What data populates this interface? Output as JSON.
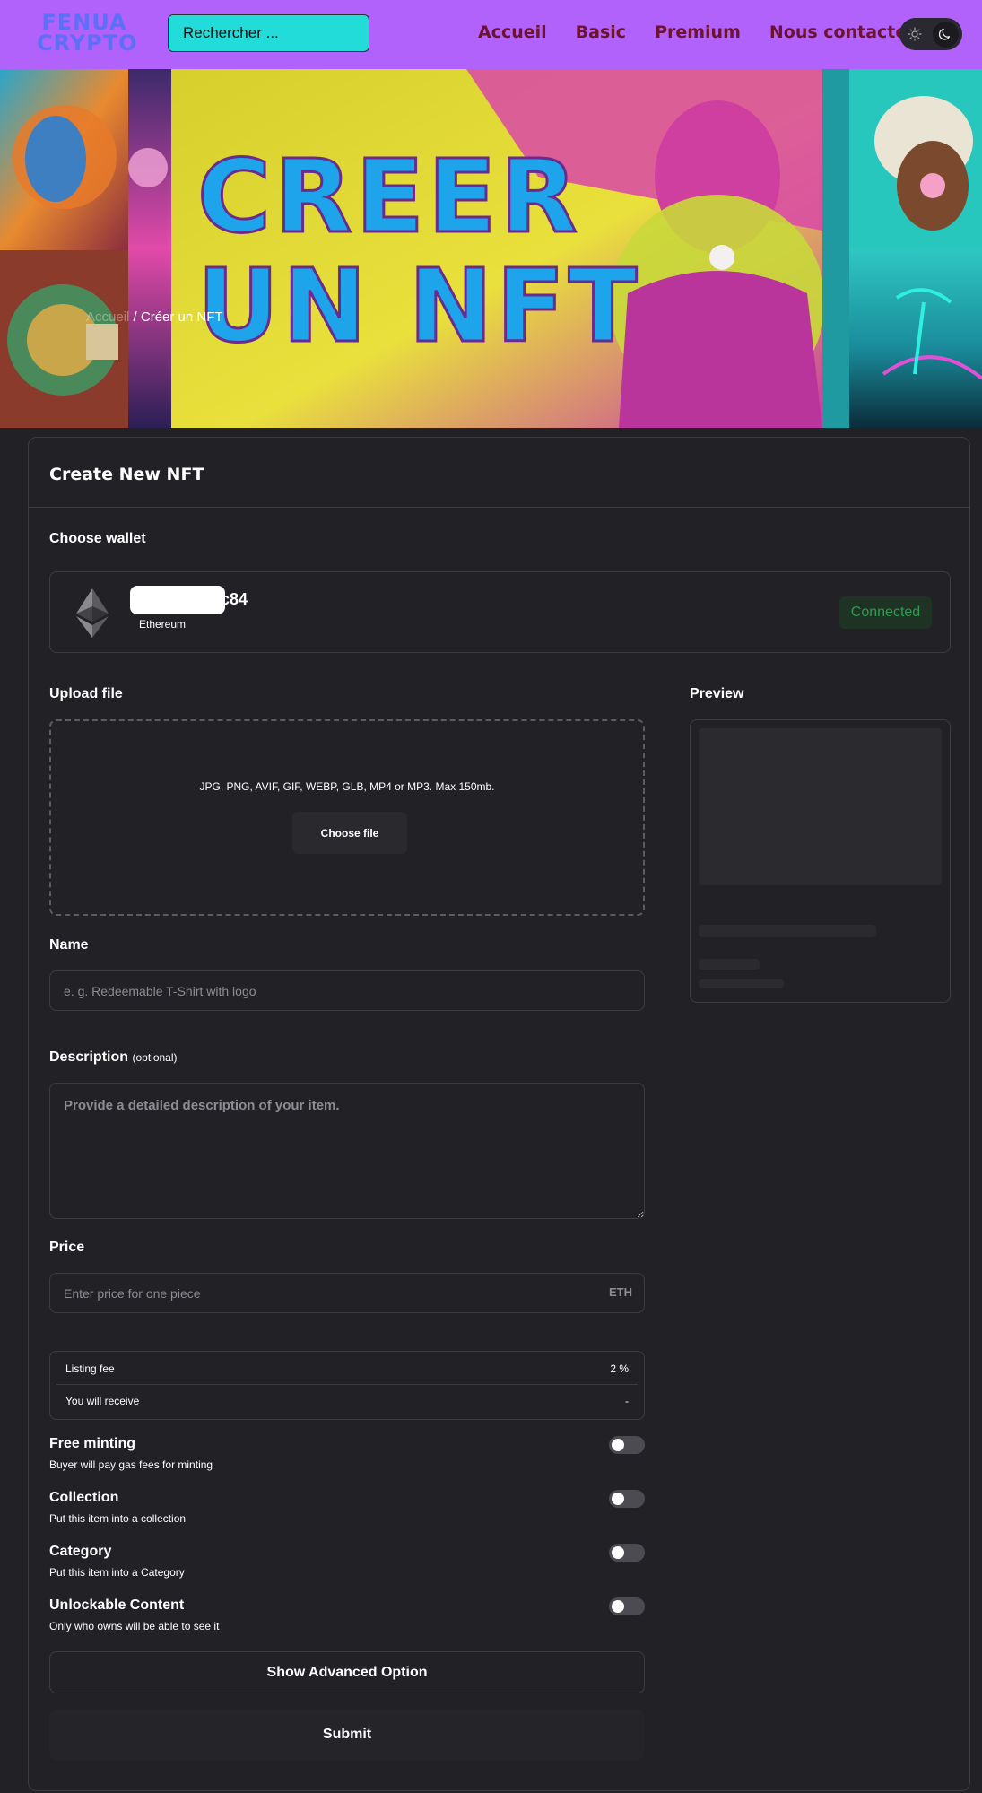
{
  "header": {
    "logo_line1": "FENUA",
    "logo_line2": "CRYPTO",
    "search_placeholder": "Rechercher ...",
    "nav": [
      "Accueil",
      "Basic",
      "Premium",
      "Nous contacter"
    ]
  },
  "banner": {
    "breadcrumb_home": "Accueil",
    "breadcrumb_sep": " / ",
    "breadcrumb_current": "Créer un NFT",
    "headline_line1": "CREER",
    "headline_line2": "UN NFT"
  },
  "form": {
    "title": "Create New NFT",
    "choose_wallet": "Choose wallet",
    "wallet": {
      "address_suffix": "c84",
      "network": "Ethereum",
      "status": "Connected"
    },
    "upload_label": "Upload file",
    "preview_label": "Preview",
    "upload_hint": "JPG, PNG, AVIF, GIF, WEBP, GLB, MP4 or MP3. Max 150mb.",
    "choose_file": "Choose file",
    "name_label": "Name",
    "name_placeholder": "e. g. Redeemable T-Shirt with logo",
    "description_label": "Description",
    "description_optional": "(optional)",
    "description_placeholder": "Provide a detailed description of your item.",
    "price_label": "Price",
    "price_placeholder": "Enter price for one piece",
    "price_unit": "ETH",
    "fees": {
      "listing_fee_label": "Listing fee",
      "listing_fee_value": "2 %",
      "receive_label": "You will receive",
      "receive_value": "-"
    },
    "options": [
      {
        "title": "Free minting",
        "subtitle": "Buyer will pay gas fees for minting"
      },
      {
        "title": "Collection",
        "subtitle": "Put this item into a collection"
      },
      {
        "title": "Category",
        "subtitle": "Put this item into a Category"
      },
      {
        "title": "Unlockable Content",
        "subtitle": "Only who owns will be able to see it"
      }
    ],
    "advanced_button": "Show Advanced Option",
    "submit_button": "Submit"
  },
  "colors": {
    "header_bg": "#b062fb",
    "search_bg": "#21dcd8",
    "nav_text": "#6d1330",
    "page_bg": "#222126",
    "connected_text": "#2e9a4e"
  }
}
